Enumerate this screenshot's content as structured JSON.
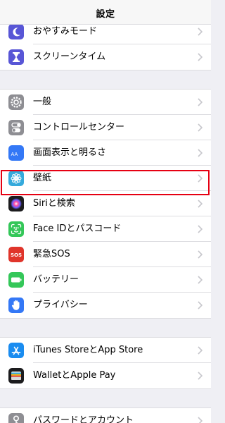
{
  "header": {
    "title": "設定"
  },
  "groups": [
    {
      "items": [
        {
          "label": "おやすみモード",
          "icon": "moon-icon",
          "color": "#5856d6"
        },
        {
          "label": "スクリーンタイム",
          "icon": "hourglass-icon",
          "color": "#5856d6"
        }
      ]
    },
    {
      "items": [
        {
          "label": "一般",
          "icon": "gear-icon",
          "color": "#8e8e93"
        },
        {
          "label": "コントロールセンター",
          "icon": "toggles-icon",
          "color": "#8e8e93"
        },
        {
          "label": "画面表示と明るさ",
          "icon": "text-size-icon",
          "color": "#3478f6",
          "icon_text": "AA"
        },
        {
          "label": "壁紙",
          "icon": "flower-icon",
          "color": "#35aadc"
        },
        {
          "label": "Siriと検索",
          "icon": "siri-icon",
          "color": "#1c1c1e",
          "highlighted": true
        },
        {
          "label": "Face IDとパスコード",
          "icon": "face-id-icon",
          "color": "#34c759"
        },
        {
          "label": "緊急SOS",
          "icon": "sos-icon",
          "color": "#e0352b",
          "icon_text": "SOS"
        },
        {
          "label": "バッテリー",
          "icon": "battery-icon",
          "color": "#34c759"
        },
        {
          "label": "プライバシー",
          "icon": "hand-icon",
          "color": "#3478f6"
        }
      ]
    },
    {
      "items": [
        {
          "label": "iTunes StoreとApp Store",
          "icon": "app-store-icon",
          "color": "#1a8cf0"
        },
        {
          "label": "WalletとApple Pay",
          "icon": "wallet-icon",
          "color": "#1c1c1e"
        }
      ]
    },
    {
      "items": [
        {
          "label": "パスワードとアカウント",
          "icon": "key-icon",
          "color": "#8e8e93"
        }
      ]
    }
  ],
  "colors": {
    "highlight_border": "#e60012",
    "chevron": "#c7c7cc",
    "background": "#efeff4"
  }
}
